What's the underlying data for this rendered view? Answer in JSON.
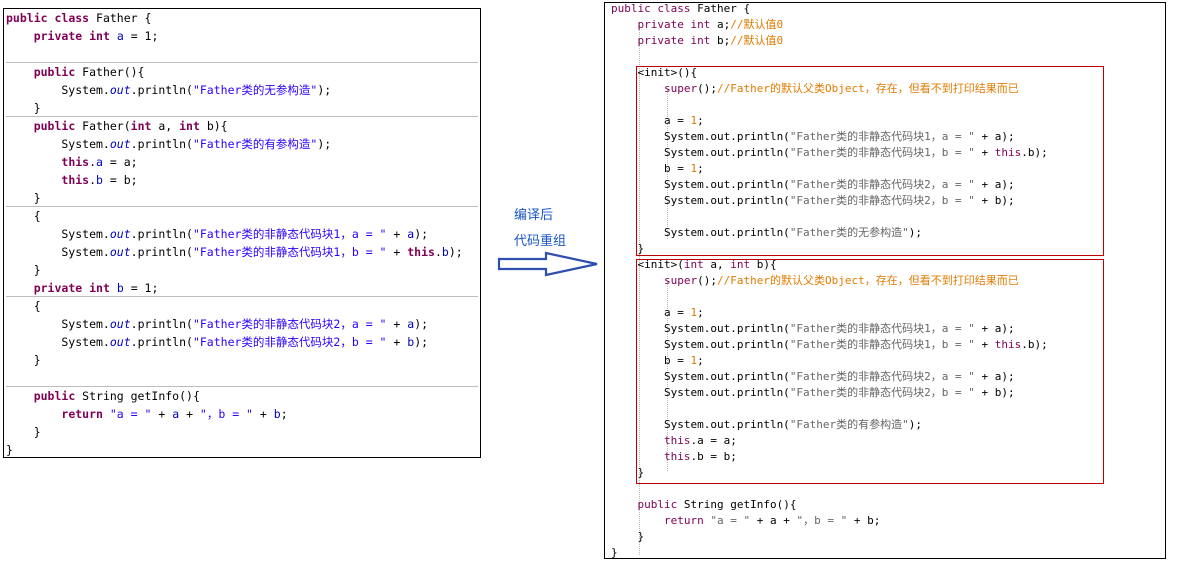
{
  "left_code": {
    "lines": [
      [
        {
          "t": "public",
          "c": "kw"
        },
        {
          "t": " "
        },
        {
          "t": "class",
          "c": "kw"
        },
        {
          "t": " Father {"
        }
      ],
      [
        {
          "t": "    "
        },
        {
          "t": "private",
          "c": "kw"
        },
        {
          "t": " "
        },
        {
          "t": "int",
          "c": "kw"
        },
        {
          "t": " "
        },
        {
          "t": "a",
          "c": "fld"
        },
        {
          "t": " = 1;"
        }
      ],
      [],
      [
        {
          "t": "    "
        },
        {
          "t": "public",
          "c": "kw"
        },
        {
          "t": " Father(){"
        }
      ],
      [
        {
          "t": "        System."
        },
        {
          "t": "out",
          "c": "it"
        },
        {
          "t": ".println("
        },
        {
          "t": "\"Father类的无参构造\"",
          "c": "str"
        },
        {
          "t": ");"
        }
      ],
      [
        {
          "t": "    }"
        }
      ],
      [
        {
          "t": "    "
        },
        {
          "t": "public",
          "c": "kw"
        },
        {
          "t": " Father("
        },
        {
          "t": "int",
          "c": "kw"
        },
        {
          "t": " a, "
        },
        {
          "t": "int",
          "c": "kw"
        },
        {
          "t": " b){"
        }
      ],
      [
        {
          "t": "        System."
        },
        {
          "t": "out",
          "c": "it"
        },
        {
          "t": ".println("
        },
        {
          "t": "\"Father类的有参构造\"",
          "c": "str"
        },
        {
          "t": ");"
        }
      ],
      [
        {
          "t": "        "
        },
        {
          "t": "this",
          "c": "kw"
        },
        {
          "t": "."
        },
        {
          "t": "a",
          "c": "fld"
        },
        {
          "t": " = a;"
        }
      ],
      [
        {
          "t": "        "
        },
        {
          "t": "this",
          "c": "kw"
        },
        {
          "t": "."
        },
        {
          "t": "b",
          "c": "fld"
        },
        {
          "t": " = b;"
        }
      ],
      [
        {
          "t": "    }"
        }
      ],
      [
        {
          "t": "    {"
        }
      ],
      [
        {
          "t": "        System."
        },
        {
          "t": "out",
          "c": "it"
        },
        {
          "t": ".println("
        },
        {
          "t": "\"Father类的非静态代码块1，a = \"",
          "c": "str"
        },
        {
          "t": " + "
        },
        {
          "t": "a",
          "c": "fld"
        },
        {
          "t": ");"
        }
      ],
      [
        {
          "t": "        System."
        },
        {
          "t": "out",
          "c": "it"
        },
        {
          "t": ".println("
        },
        {
          "t": "\"Father类的非静态代码块1，b = \"",
          "c": "str"
        },
        {
          "t": " + "
        },
        {
          "t": "this",
          "c": "kw"
        },
        {
          "t": "."
        },
        {
          "t": "b",
          "c": "fld"
        },
        {
          "t": ");"
        }
      ],
      [
        {
          "t": "    }"
        }
      ],
      [
        {
          "t": "    "
        },
        {
          "t": "private",
          "c": "kw"
        },
        {
          "t": " "
        },
        {
          "t": "int",
          "c": "kw"
        },
        {
          "t": " "
        },
        {
          "t": "b",
          "c": "fld"
        },
        {
          "t": " = 1;"
        }
      ],
      [
        {
          "t": "    {"
        }
      ],
      [
        {
          "t": "        System."
        },
        {
          "t": "out",
          "c": "it"
        },
        {
          "t": ".println("
        },
        {
          "t": "\"Father类的非静态代码块2，a = \"",
          "c": "str"
        },
        {
          "t": " + "
        },
        {
          "t": "a",
          "c": "fld"
        },
        {
          "t": ");"
        }
      ],
      [
        {
          "t": "        System."
        },
        {
          "t": "out",
          "c": "it"
        },
        {
          "t": ".println("
        },
        {
          "t": "\"Father类的非静态代码块2，b = \"",
          "c": "str"
        },
        {
          "t": " + "
        },
        {
          "t": "b",
          "c": "fld"
        },
        {
          "t": ");"
        }
      ],
      [
        {
          "t": "    }"
        }
      ],
      [],
      [
        {
          "t": "    "
        },
        {
          "t": "public",
          "c": "kw"
        },
        {
          "t": " String getInfo(){"
        }
      ],
      [
        {
          "t": "        "
        },
        {
          "t": "return",
          "c": "kw"
        },
        {
          "t": " "
        },
        {
          "t": "\"a = \"",
          "c": "str"
        },
        {
          "t": " + "
        },
        {
          "t": "a",
          "c": "fld"
        },
        {
          "t": " + "
        },
        {
          "t": "\"，b = \"",
          "c": "str"
        },
        {
          "t": " + "
        },
        {
          "t": "b",
          "c": "fld"
        },
        {
          "t": ";"
        }
      ],
      [
        {
          "t": "    }"
        }
      ],
      [
        {
          "t": "}"
        }
      ]
    ]
  },
  "arrow": {
    "label_1": "编译后",
    "label_2": "代码重组"
  },
  "right_code": {
    "lines": [
      [
        {
          "t": "public",
          "c": "kw"
        },
        {
          "t": " "
        },
        {
          "t": "class",
          "c": "kw"
        },
        {
          "t": " Father {"
        }
      ],
      [
        {
          "t": "    "
        },
        {
          "t": "private",
          "c": "kw"
        },
        {
          "t": " "
        },
        {
          "t": "int",
          "c": "kw"
        },
        {
          "t": " a;"
        },
        {
          "t": "//默认值0",
          "c": "cmt"
        }
      ],
      [
        {
          "t": "    "
        },
        {
          "t": "private",
          "c": "kw"
        },
        {
          "t": " "
        },
        {
          "t": "int",
          "c": "kw"
        },
        {
          "t": " b;"
        },
        {
          "t": "//默认值0",
          "c": "cmt"
        }
      ],
      [],
      [
        {
          "t": "    <init>(){"
        }
      ],
      [
        {
          "t": "        "
        },
        {
          "t": "super",
          "c": "kw"
        },
        {
          "t": "();"
        },
        {
          "t": "//Father的默认父类Object，存在，但看不到打印结果而已",
          "c": "cmt"
        }
      ],
      [],
      [
        {
          "t": "        a = "
        },
        {
          "t": "1",
          "c": "num"
        },
        {
          "t": ";"
        }
      ],
      [
        {
          "t": "        System.out.println("
        },
        {
          "t": "\"Father类的非静态代码块1，a = \"",
          "c": "str"
        },
        {
          "t": " + a);"
        }
      ],
      [
        {
          "t": "        System.out.println("
        },
        {
          "t": "\"Father类的非静态代码块1，b = \"",
          "c": "str"
        },
        {
          "t": " + "
        },
        {
          "t": "this",
          "c": "kw"
        },
        {
          "t": ".b);"
        }
      ],
      [
        {
          "t": "        b = "
        },
        {
          "t": "1",
          "c": "num"
        },
        {
          "t": ";"
        }
      ],
      [
        {
          "t": "        System.out.println("
        },
        {
          "t": "\"Father类的非静态代码块2，a = \"",
          "c": "str"
        },
        {
          "t": " + a);"
        }
      ],
      [
        {
          "t": "        System.out.println("
        },
        {
          "t": "\"Father类的非静态代码块2，b = \"",
          "c": "str"
        },
        {
          "t": " + b);"
        }
      ],
      [],
      [
        {
          "t": "        System.out.println("
        },
        {
          "t": "\"Father类的无参构造\"",
          "c": "str"
        },
        {
          "t": ");"
        }
      ],
      [
        {
          "t": "    }"
        }
      ],
      [
        {
          "t": "    <init>("
        },
        {
          "t": "int",
          "c": "kw"
        },
        {
          "t": " a, "
        },
        {
          "t": "int",
          "c": "kw"
        },
        {
          "t": " b){"
        }
      ],
      [
        {
          "t": "        "
        },
        {
          "t": "super",
          "c": "kw"
        },
        {
          "t": "();"
        },
        {
          "t": "//Father的默认父类Object，存在，但看不到打印结果而已",
          "c": "cmt"
        }
      ],
      [],
      [
        {
          "t": "        a = "
        },
        {
          "t": "1",
          "c": "num"
        },
        {
          "t": ";"
        }
      ],
      [
        {
          "t": "        System.out.println("
        },
        {
          "t": "\"Father类的非静态代码块1，a = \"",
          "c": "str"
        },
        {
          "t": " + a);"
        }
      ],
      [
        {
          "t": "        System.out.println("
        },
        {
          "t": "\"Father类的非静态代码块1，b = \"",
          "c": "str"
        },
        {
          "t": " + "
        },
        {
          "t": "this",
          "c": "kw"
        },
        {
          "t": ".b);"
        }
      ],
      [
        {
          "t": "        b = "
        },
        {
          "t": "1",
          "c": "num"
        },
        {
          "t": ";"
        }
      ],
      [
        {
          "t": "        System.out.println("
        },
        {
          "t": "\"Father类的非静态代码块2，a = \"",
          "c": "str"
        },
        {
          "t": " + a);"
        }
      ],
      [
        {
          "t": "        System.out.println("
        },
        {
          "t": "\"Father类的非静态代码块2，b = \"",
          "c": "str"
        },
        {
          "t": " + b);"
        }
      ],
      [],
      [
        {
          "t": "        System.out.println("
        },
        {
          "t": "\"Father类的有参构造\"",
          "c": "str"
        },
        {
          "t": ");"
        }
      ],
      [
        {
          "t": "        "
        },
        {
          "t": "this",
          "c": "kw"
        },
        {
          "t": ".a = a;"
        }
      ],
      [
        {
          "t": "        "
        },
        {
          "t": "this",
          "c": "kw"
        },
        {
          "t": ".b = b;"
        }
      ],
      [
        {
          "t": "    }"
        }
      ],
      [],
      [
        {
          "t": "    "
        },
        {
          "t": "public",
          "c": "kw"
        },
        {
          "t": " String getInfo(){"
        }
      ],
      [
        {
          "t": "        "
        },
        {
          "t": "return",
          "c": "kw"
        },
        {
          "t": " "
        },
        {
          "t": "\"a = \"",
          "c": "str"
        },
        {
          "t": " + a + "
        },
        {
          "t": "\"，b = \"",
          "c": "str"
        },
        {
          "t": " + b;"
        }
      ],
      [
        {
          "t": "    }"
        }
      ],
      [
        {
          "t": "}"
        }
      ]
    ]
  },
  "colors": {
    "keyword": "#7f0055",
    "field": "#0000c0",
    "string_left": "#2a00ff",
    "comment_right": "#e07b00",
    "box_border": "#c00000",
    "arrow": "#2f4fb0",
    "arrow_label": "#1a56c4"
  },
  "icons": [
    "right-arrow-icon"
  ]
}
